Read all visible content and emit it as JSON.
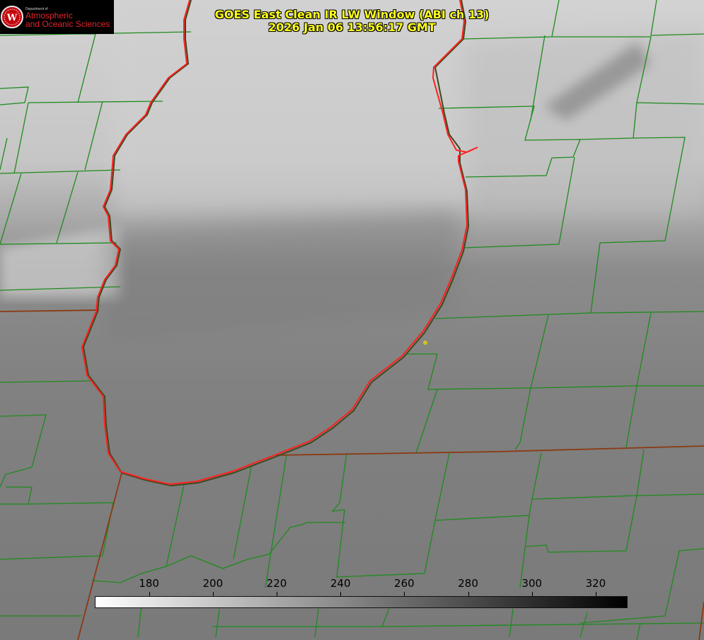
{
  "title": {
    "line1": "GOES East Clean IR LW Window (ABI ch 13)",
    "line2": "2026 Jan 06 13:56:17 GMT"
  },
  "logo": {
    "dept": "Department of",
    "line1": "Atmospheric",
    "line2": "and Oceanic Sciences",
    "emblem_letter": "W"
  },
  "colorbar": {
    "min": 163,
    "max": 330,
    "ticks": [
      "180",
      "200",
      "220",
      "240",
      "260",
      "280",
      "300",
      "320"
    ],
    "tick_values": [
      180,
      200,
      220,
      240,
      260,
      280,
      300,
      320
    ],
    "color_low": "#ffffff",
    "color_high": "#000000"
  },
  "colors": {
    "county_lines": "#1f8a1f",
    "state_lines": "#8a3a12",
    "lake_outline": "#ff2020",
    "title_text": "#ffff1a",
    "marker": "#d4c21a"
  }
}
